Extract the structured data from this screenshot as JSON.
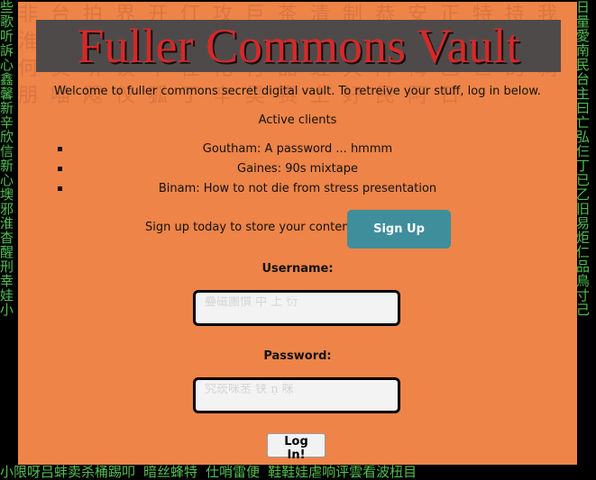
{
  "page": {
    "title": "Fuller Commons Vault",
    "welcome": "Welcome to fuller commons secret digital vault. To retreive your stuff, log in below.",
    "clients_heading": "Active clients",
    "clients": [
      "Goutham: A password ... hmmm",
      "Gaines: 90s mixtape",
      "Binam: How to not die from stress presentation"
    ]
  },
  "signup": {
    "prompt": "Sign up today to store your content.",
    "button_label": "Sign Up"
  },
  "login": {
    "username_label": "Username:",
    "username_value": "",
    "password_label": "Password:",
    "password_value": "",
    "submit_label": "Log In!"
  },
  "decor": {
    "left_glyphs": "些歌听訴心鑫馨新辛欣信新心墺邪淮杳醒刑幸娃小",
    "right_glyphs": "日量愛南民台主曰亡弘仨丁已乙旧易炬仁品鳥寸己",
    "bottom_glyphs": "小限呀吕蚌卖杀桶踢叩 暗丝蜂特 仕哨雷便 鞋鞋娃虐响评雲看波杻目",
    "panel_glyphs": "非台拍界开仃攻巨茶清制恭安正特持我淮抢太兖飞吧晓舍咪和仙伯淳死内减土何卖听谈中仕化付品蛏兵阵悔乙亡的凋朋喵飕仪狐丁辛吴赛上好民阿日"
  },
  "colors": {
    "panel": "#ee8448",
    "title_text": "#d42a2a",
    "title_box": "#4f4a4a",
    "signup_button": "#3e8e9c",
    "rain": "#5bd35b"
  }
}
